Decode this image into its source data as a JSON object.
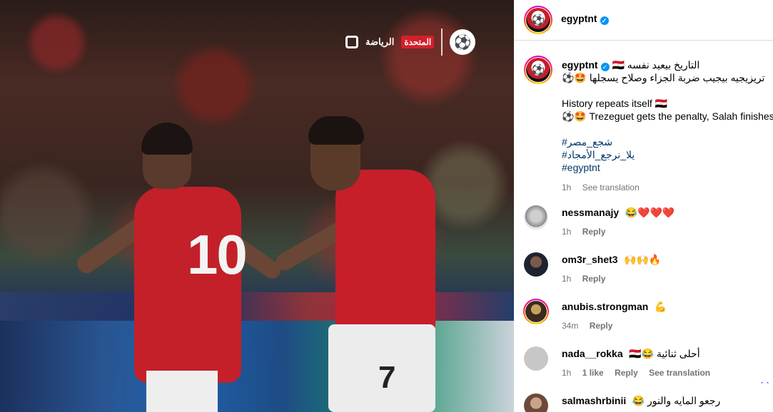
{
  "photo": {
    "logo_left": "الرياضة",
    "logo_red": "المتحدة",
    "logo_efa": "⚽",
    "player1_number": "10",
    "player2_number": "7"
  },
  "header": {
    "username": "egyptnt",
    "verified": "✓"
  },
  "caption": {
    "username": "egyptnt",
    "line_ar_1": "التاريخ بيعيد نفسه 🇪🇬",
    "line_ar_2": "تريزيجيه بيجيب ضربة الجزاء وصلاح يسجلها 🤩⚽️",
    "line_en_1": "History repeats itself 🇪🇬",
    "line_en_2": "⚽️🤩 Trezeguet gets the penalty, Salah finishes it",
    "hashtag_1": "#شجع_مصر",
    "hashtag_2": "#يلا_نرجع_الأمجاد",
    "hashtag_3": "#egyptnt",
    "time": "1h",
    "see_translation": "See translation"
  },
  "comments": [
    {
      "username": "nessmanajy",
      "text": "😂❤️❤️❤️",
      "time": "1h",
      "reply": "Reply"
    },
    {
      "username": "om3r_shet3",
      "text": "🙌🙌🔥",
      "time": "1h",
      "reply": "Reply"
    },
    {
      "username": "anubis.strongman",
      "text": "💪",
      "time": "34m",
      "reply": "Reply"
    },
    {
      "username": "nada__rokka",
      "text": "🇪🇬😂 أحلى ثنائية",
      "time": "1h",
      "likes": "1 like",
      "reply": "Reply",
      "see_translation": "See translation"
    },
    {
      "username": "salmashrbinii",
      "text": "😂 رجعو المايه والنور"
    }
  ],
  "colors": {
    "accent": "#0095f6",
    "jersey_red": "#c3202a",
    "secondary_text": "#737373"
  }
}
